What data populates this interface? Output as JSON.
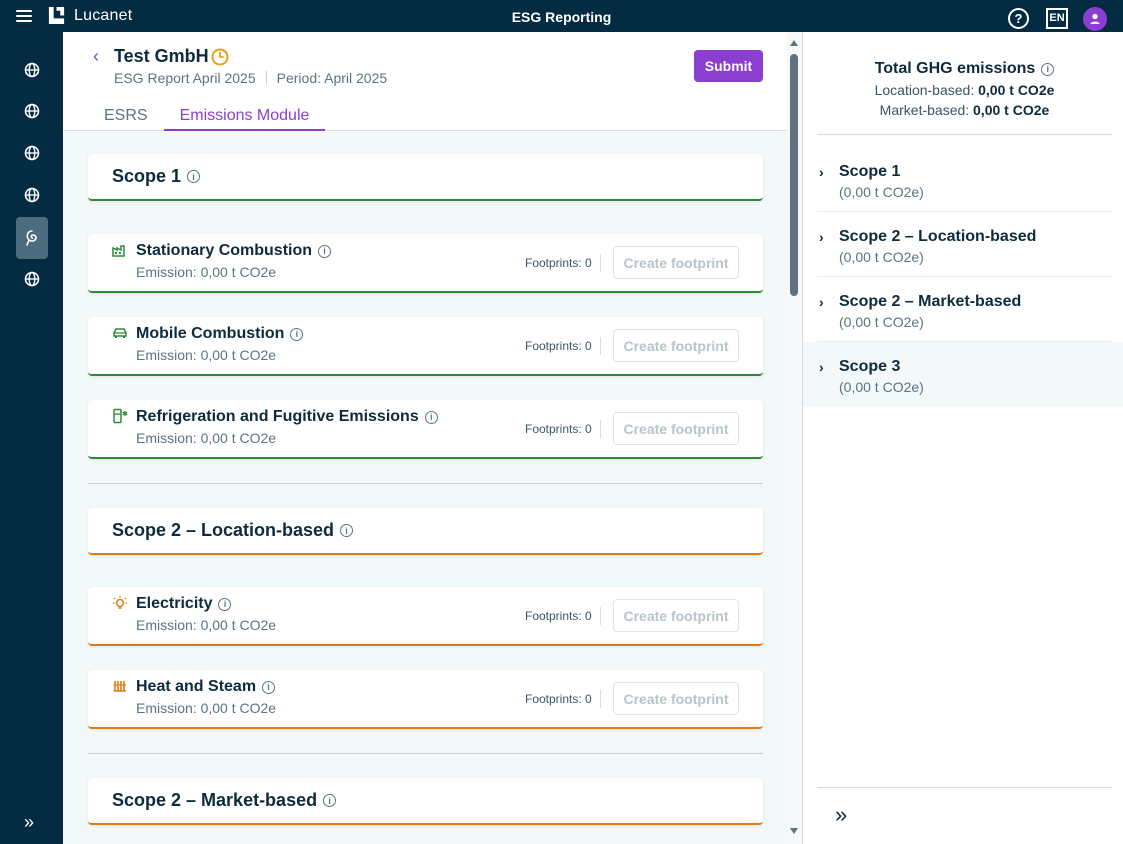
{
  "app": {
    "brand": "Lucanet",
    "title": "ESG Reporting",
    "lang": "EN",
    "help": "?"
  },
  "header": {
    "company": "Test GmbH",
    "report": "ESG Report April 2025",
    "period": "Period: April 2025",
    "submit_label": "Submit",
    "tabs": [
      {
        "label": "ESRS"
      },
      {
        "label": "Emissions Module"
      }
    ]
  },
  "sections": [
    {
      "title": "Scope 1",
      "items": [
        {
          "name": "Stationary Combustion",
          "emission": "Emission: 0,00 t CO2e",
          "footprints": "Footprints: 0",
          "action": "Create footprint"
        },
        {
          "name": "Mobile Combustion",
          "emission": "Emission: 0,00 t CO2e",
          "footprints": "Footprints: 0",
          "action": "Create footprint"
        },
        {
          "name": "Refrigeration and Fugitive Emissions",
          "emission": "Emission: 0,00 t CO2e",
          "footprints": "Footprints: 0",
          "action": "Create footprint"
        }
      ]
    },
    {
      "title": "Scope 2 – Location-based",
      "items": [
        {
          "name": "Electricity",
          "emission": "Emission: 0,00 t CO2e",
          "footprints": "Footprints: 0",
          "action": "Create footprint"
        },
        {
          "name": "Heat and Steam",
          "emission": "Emission: 0,00 t CO2e",
          "footprints": "Footprints: 0",
          "action": "Create footprint"
        }
      ]
    },
    {
      "title": "Scope 2 – Market-based",
      "items": []
    }
  ],
  "summary": {
    "title": "Total GHG emissions",
    "location_label": "Location-based:",
    "location_value": "0,00 t CO2e",
    "market_label": "Market-based:",
    "market_value": "0,00 t CO2e",
    "scopes": [
      {
        "name": "Scope 1",
        "value": "(0,00 t CO2e)"
      },
      {
        "name": "Scope 2 – Location-based",
        "value": "(0,00 t CO2e)"
      },
      {
        "name": "Scope 2 – Market-based",
        "value": "(0,00 t CO2e)"
      },
      {
        "name": "Scope 3",
        "value": "(0,00 t CO2e)"
      }
    ]
  },
  "icons": {
    "rail": [
      "globe-icon",
      "globe-icon",
      "globe-icon",
      "globe-icon",
      "emissions-icon",
      "globe-icon"
    ],
    "expand": "»",
    "collapse": "»",
    "info": "i",
    "chevron": "›",
    "back": "‹"
  },
  "colors": {
    "topbar": "#032b42",
    "accent": "#8a3fd1",
    "scope1": "#2e8b3a",
    "scope2": "#de7b16"
  }
}
